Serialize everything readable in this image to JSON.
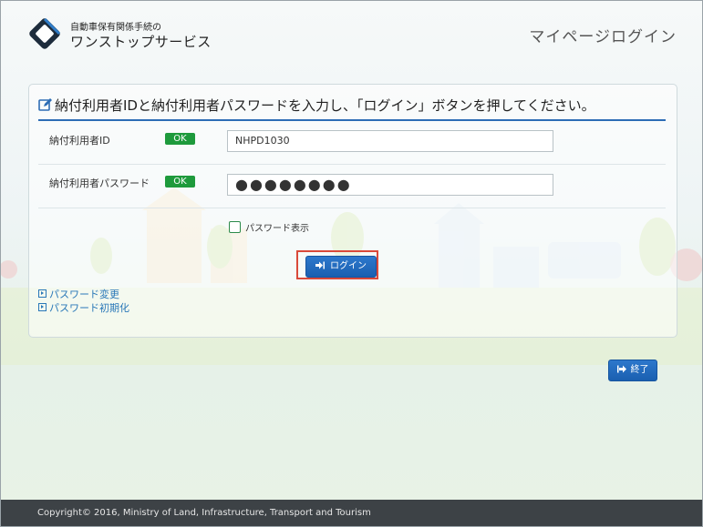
{
  "header": {
    "brand_top": "自動車保有関係手続の",
    "brand_main": "ワンストップサービス",
    "page_title": "マイページログイン"
  },
  "form": {
    "heading": "納付利用者IDと納付利用者パスワードを入力し、「ログイン」ボタンを押してください。",
    "user_id_label": "納付利用者ID",
    "user_id_status": "OK",
    "user_id_value": "NHPD1030",
    "password_label": "納付利用者パスワード",
    "password_status": "OK",
    "password_value": "●●●●●●●●",
    "show_password_label": "パスワード表示",
    "login_label": "ログイン"
  },
  "links": {
    "change_password": "パスワード変更",
    "reset_password": "パスワード初期化"
  },
  "exit_label": "終了",
  "footer": {
    "copyright": "Copyright© 2016, Ministry of Land, Infrastructure, Transport and Tourism"
  },
  "colors": {
    "accent": "#2d6db5",
    "ok_green": "#1e9a3c",
    "highlight_red": "#d9493a",
    "footer_bg": "#3d4246"
  },
  "icons": {
    "logo": "diamond-logo-icon",
    "heading": "edit-icon",
    "login": "sign-in-icon",
    "exit": "sign-out-icon",
    "link_bullet": "play-square-icon"
  }
}
